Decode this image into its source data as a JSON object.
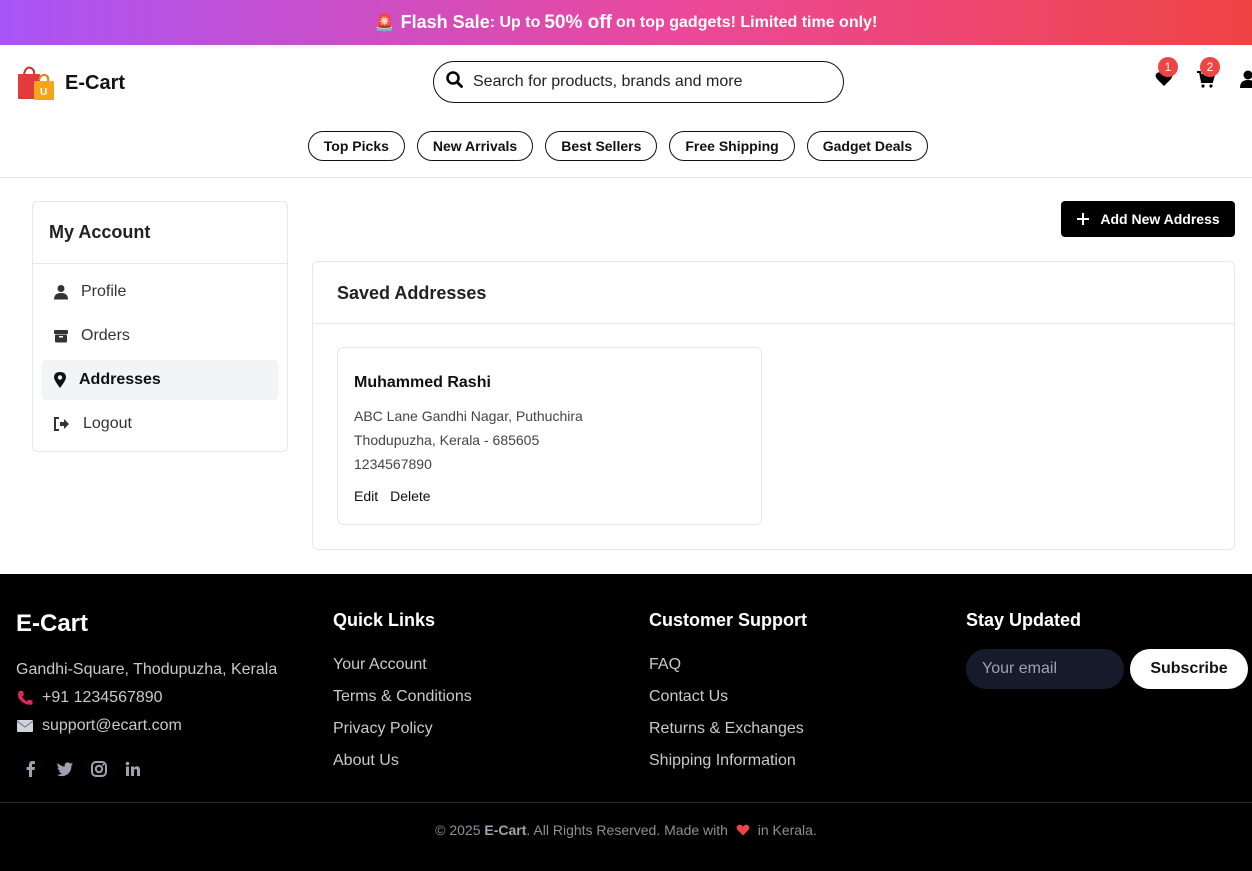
{
  "banner": {
    "siren": "🚨",
    "sale_label": "Flash Sale",
    "text_before": ": Up to",
    "discount": "50% off",
    "text_after": "on top gadgets! Limited time only!"
  },
  "header": {
    "brand": "E-Cart",
    "search_placeholder": "Search for products, brands and more",
    "wishlist_count": "1",
    "cart_count": "2"
  },
  "categories": [
    "Top Picks",
    "New Arrivals",
    "Best Sellers",
    "Free Shipping",
    "Gadget Deals"
  ],
  "sidebar": {
    "title": "My Account",
    "items": [
      {
        "label": "Profile",
        "icon": "user-icon"
      },
      {
        "label": "Orders",
        "icon": "box-icon"
      },
      {
        "label": "Addresses",
        "icon": "map-pin-icon"
      },
      {
        "label": "Logout",
        "icon": "logout-icon"
      }
    ],
    "active_index": 2
  },
  "add_address_label": "Add New Address",
  "addresses_panel": {
    "title": "Saved Addresses",
    "addresses": [
      {
        "name": "Muhammed Rashi",
        "line1": "ABC Lane Gandhi Nagar, Puthuchira",
        "line2": "Thodupuzha, Kerala - 685605",
        "phone": "1234567890",
        "edit_label": "Edit",
        "delete_label": "Delete"
      }
    ]
  },
  "footer": {
    "brand": "E-Cart",
    "address": "Gandhi-Square, Thodupuzha, Kerala",
    "phone": "+91 1234567890",
    "email": "support@ecart.com",
    "social": [
      "facebook-icon",
      "twitter-icon",
      "instagram-icon",
      "linkedin-icon"
    ],
    "quick_links": {
      "title": "Quick Links",
      "links": [
        "Your Account",
        "Terms & Conditions",
        "Privacy Policy",
        "About Us"
      ]
    },
    "support": {
      "title": "Customer Support",
      "links": [
        "FAQ",
        "Contact Us",
        "Returns & Exchanges",
        "Shipping Information"
      ]
    },
    "newsletter": {
      "title": "Stay Updated",
      "placeholder": "Your email",
      "button": "Subscribe"
    },
    "copyright_prefix": "© 2025",
    "copyright_brand": "E-Cart",
    "copyright_mid": ". All Rights Reserved. Made with",
    "copyright_suffix": "in Kerala."
  },
  "colors": {
    "banner_start": "#a855f7",
    "banner_end": "#ef4444",
    "badge": "#ef4444",
    "footer_bg": "#000000"
  }
}
